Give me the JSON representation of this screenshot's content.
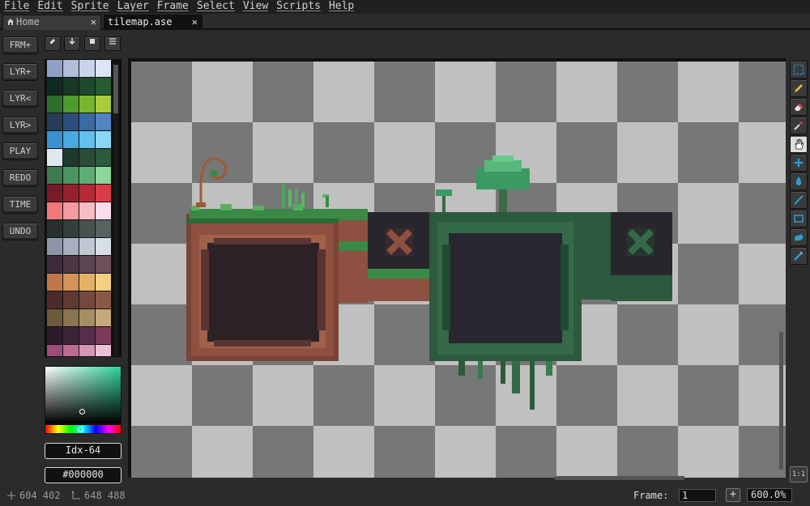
{
  "menu": [
    "File",
    "Edit",
    "Sprite",
    "Layer",
    "Frame",
    "Select",
    "View",
    "Scripts",
    "Help"
  ],
  "tabs": [
    {
      "label": "Home",
      "close": "✕"
    },
    {
      "label": "tilemap.ase",
      "close": "✕"
    }
  ],
  "left_buttons": [
    "FRM+",
    "LYR+",
    "LYR<",
    "LYR>",
    "PLAY",
    "REDO",
    "TIME",
    "UNDO"
  ],
  "palette_colors": [
    "#8fa0c8",
    "#b0bedc",
    "#c8d4ea",
    "#dde4f4",
    "#0f2a20",
    "#163824",
    "#1d4a2c",
    "#275a30",
    "#2f6e2a",
    "#4f9a2e",
    "#78b430",
    "#a8cc3c",
    "#243c5a",
    "#2c4e7a",
    "#3a6aa0",
    "#5284c0",
    "#3a90d0",
    "#4aa8e0",
    "#62c0ec",
    "#8ad6f4",
    "#dfe8f0",
    "#1e3a2c",
    "#2a4c38",
    "#2e5a3e",
    "#3c7a50",
    "#4a9460",
    "#5cae72",
    "#8cd69a",
    "#7a1a26",
    "#98202e",
    "#b82a38",
    "#d83e48",
    "#f07a7a",
    "#f49aa0",
    "#f8bcc4",
    "#fbdcec",
    "#28302e",
    "#343e3c",
    "#48524e",
    "#586260",
    "#8c96a8",
    "#a6b0c0",
    "#c0c8d4",
    "#d8dee6",
    "#3a2a3a",
    "#4c3644",
    "#5c4450",
    "#6e4e58",
    "#c0784a",
    "#d49458",
    "#e4b068",
    "#f4d084",
    "#4a2c2a",
    "#5e3a32",
    "#74483a",
    "#8a5a46",
    "#6e5a3c",
    "#8a7450",
    "#a68e64",
    "#c4aa7c",
    "#2a1a2a",
    "#3c2438",
    "#582e4a",
    "#7a3a5c",
    "#a04c78",
    "#c06a94",
    "#d894b4",
    "#ecc0d4",
    "#1a2a3c",
    "#203c52",
    "#244e66",
    "#2a647c",
    "#1a8a8a",
    "#20a6a0",
    "#28c0b6",
    "#40d8cc"
  ],
  "index_label": "Idx-64",
  "hex_label": "#000000",
  "status": {
    "cursor": "604 402",
    "size": "648 488",
    "frame_label": "Frame:",
    "frame_value": "1",
    "frame_add": "+",
    "zoom": "600.0%",
    "one_to_one": "1:1"
  },
  "tools": [
    "marquee-icon",
    "pencil-icon",
    "eraser-icon",
    "eyedropper-icon",
    "hand-icon",
    "move-icon",
    "bucket-icon",
    "line-icon",
    "rectangle-icon",
    "blob-icon",
    "brush-icon"
  ],
  "colors": {
    "accent": "#2f9cd8",
    "menubar": "#1f1f1f",
    "panel": "#2b2b2b"
  }
}
